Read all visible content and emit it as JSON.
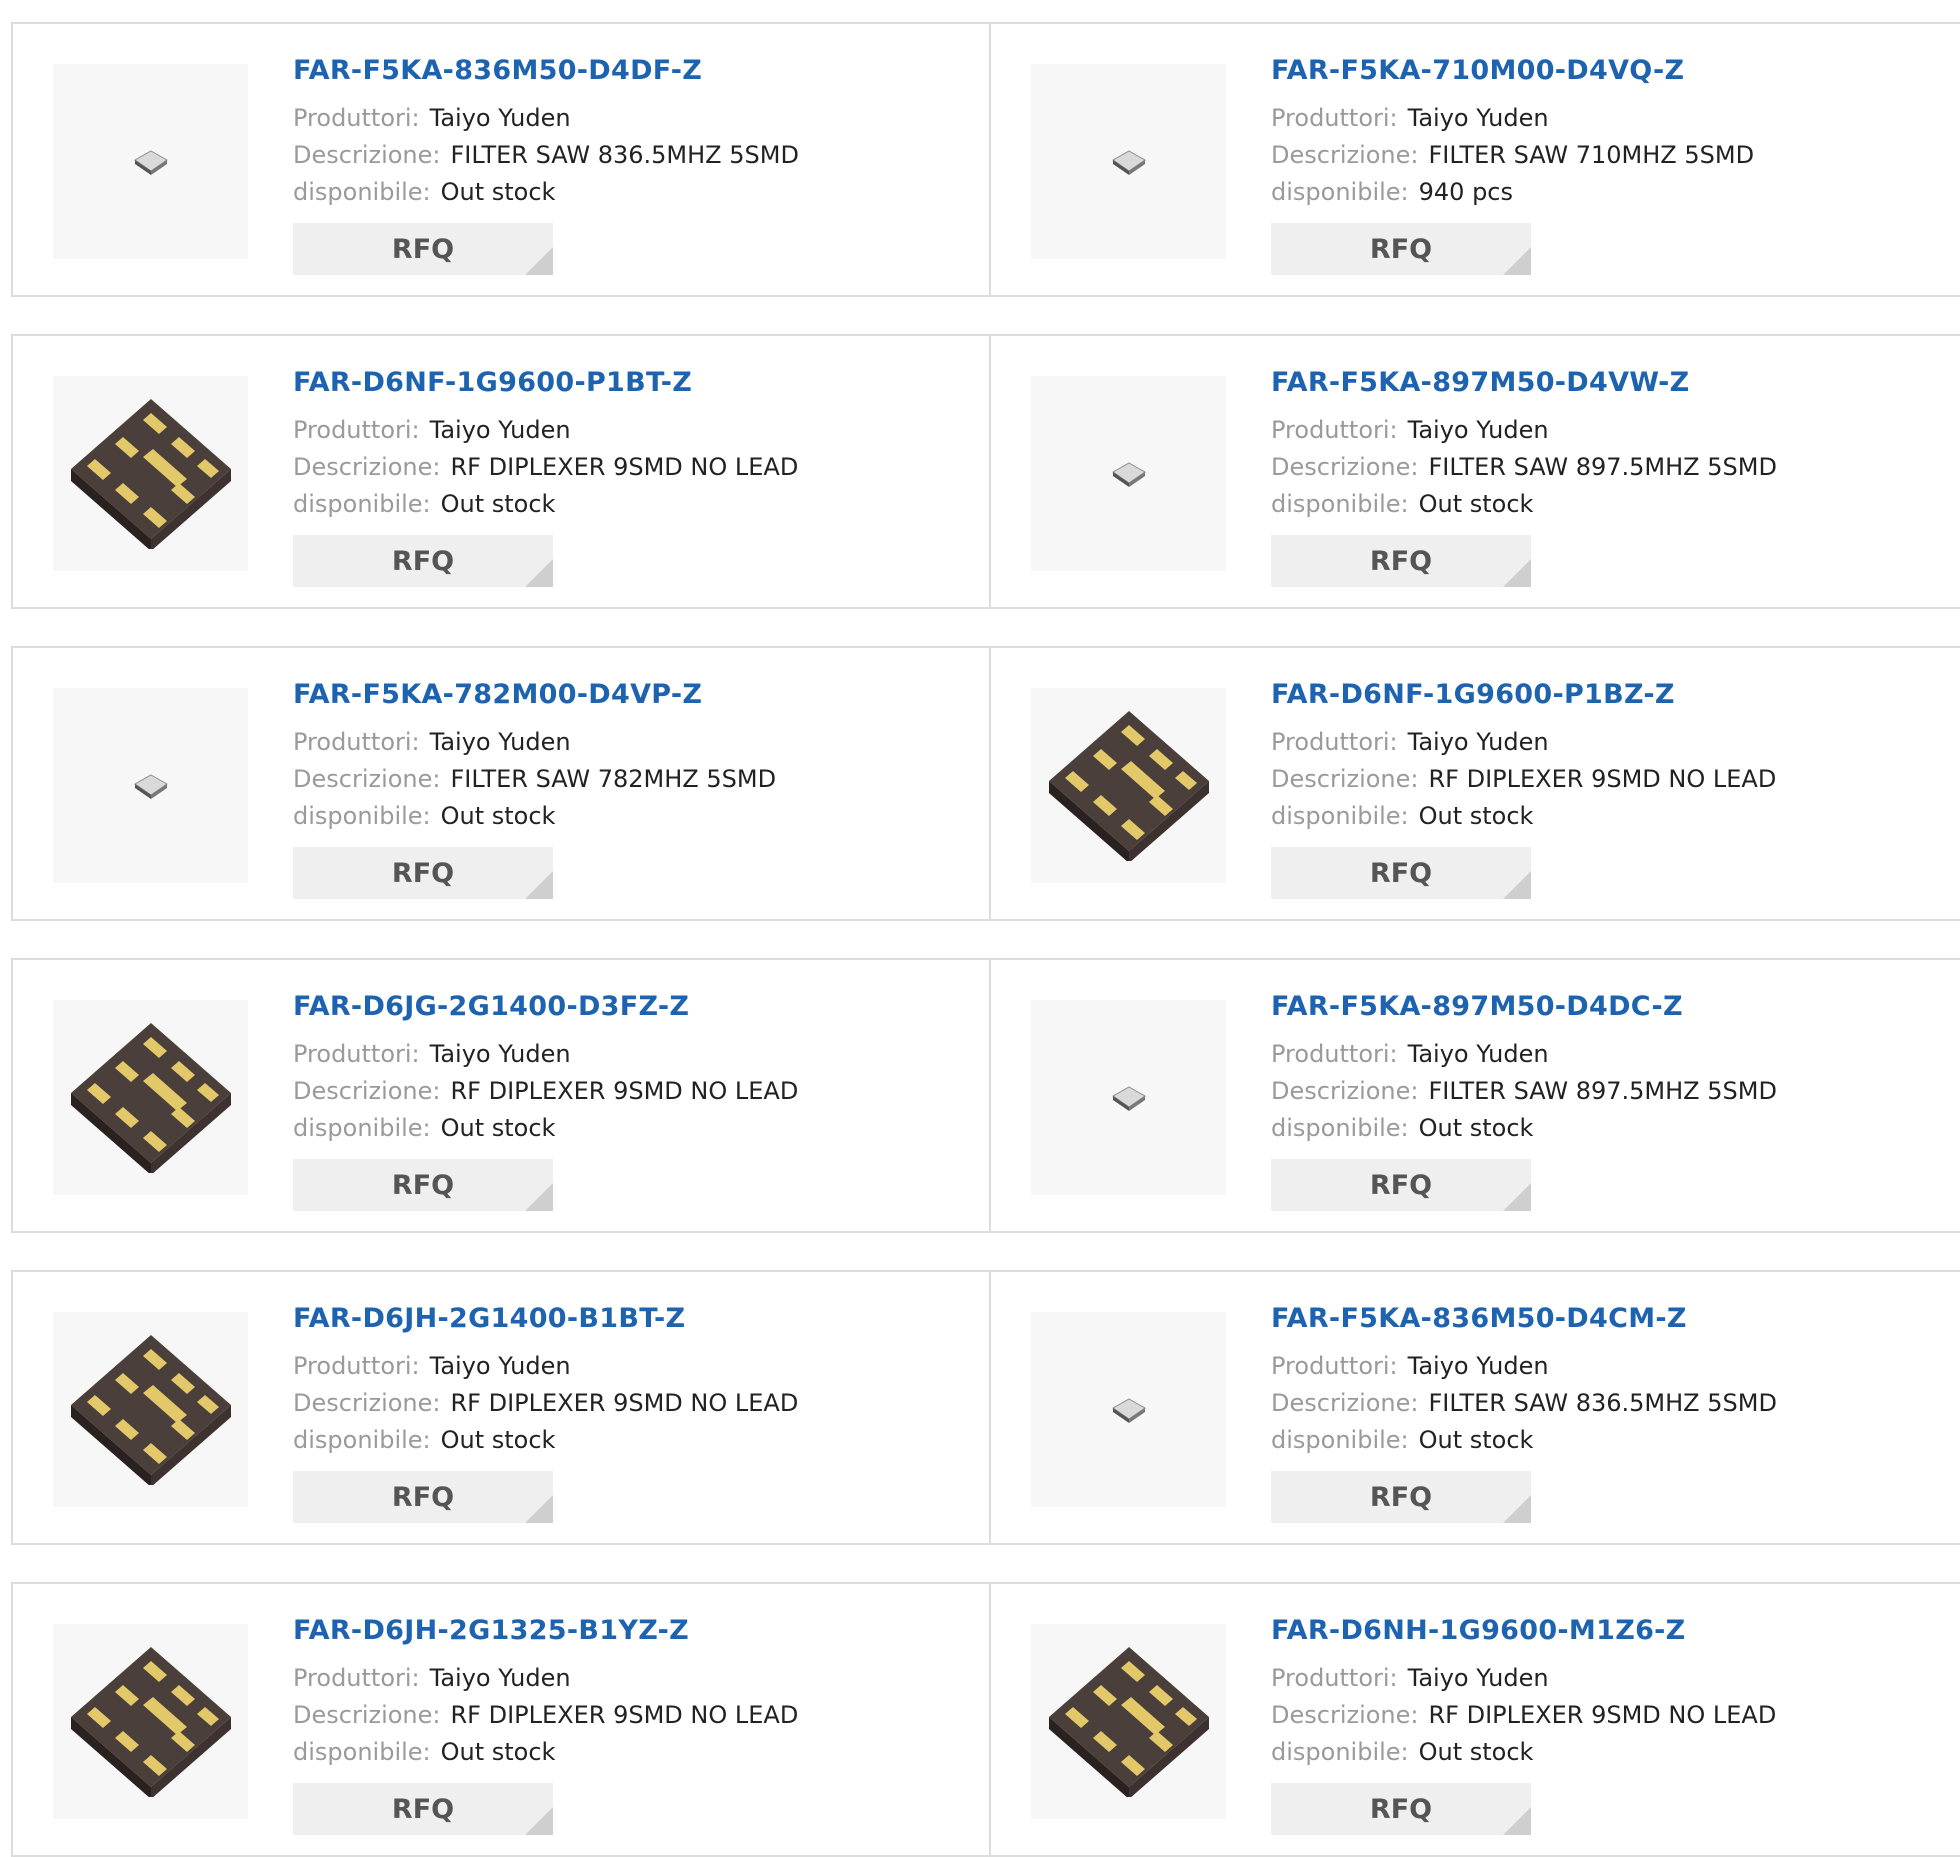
{
  "labels": {
    "manufacturer": "Produttori:",
    "description": "Descrizione:",
    "availability": "disponibile:",
    "rfq": "RFQ"
  },
  "products": [
    {
      "pn": "FAR-F5KA-836M50-D4DF-Z",
      "manufacturer": "Taiyo Yuden",
      "description": "FILTER SAW 836.5MHZ 5SMD",
      "availability": "Out stock",
      "image": "small-chip-icon"
    },
    {
      "pn": "FAR-F5KA-710M00-D4VQ-Z",
      "manufacturer": "Taiyo Yuden",
      "description": "FILTER SAW 710MHZ 5SMD",
      "availability": "940 pcs",
      "image": "small-chip-icon"
    },
    {
      "pn": "FAR-D6NF-1G9600-P1BT-Z",
      "manufacturer": "Taiyo Yuden",
      "description": "RF DIPLEXER 9SMD NO LEAD",
      "availability": "Out stock",
      "image": "diplexer-chip-icon"
    },
    {
      "pn": "FAR-F5KA-897M50-D4VW-Z",
      "manufacturer": "Taiyo Yuden",
      "description": "FILTER SAW 897.5MHZ 5SMD",
      "availability": "Out stock",
      "image": "small-chip-icon"
    },
    {
      "pn": "FAR-F5KA-782M00-D4VP-Z",
      "manufacturer": "Taiyo Yuden",
      "description": "FILTER SAW 782MHZ 5SMD",
      "availability": "Out stock",
      "image": "small-chip-icon"
    },
    {
      "pn": "FAR-D6NF-1G9600-P1BZ-Z",
      "manufacturer": "Taiyo Yuden",
      "description": "RF DIPLEXER 9SMD NO LEAD",
      "availability": "Out stock",
      "image": "diplexer-chip-icon"
    },
    {
      "pn": "FAR-D6JG-2G1400-D3FZ-Z",
      "manufacturer": "Taiyo Yuden",
      "description": "RF DIPLEXER 9SMD NO LEAD",
      "availability": "Out stock",
      "image": "diplexer-chip-icon"
    },
    {
      "pn": "FAR-F5KA-897M50-D4DC-Z",
      "manufacturer": "Taiyo Yuden",
      "description": "FILTER SAW 897.5MHZ 5SMD",
      "availability": "Out stock",
      "image": "small-chip-icon"
    },
    {
      "pn": "FAR-D6JH-2G1400-B1BT-Z",
      "manufacturer": "Taiyo Yuden",
      "description": "RF DIPLEXER 9SMD NO LEAD",
      "availability": "Out stock",
      "image": "diplexer-chip-icon"
    },
    {
      "pn": "FAR-F5KA-836M50-D4CM-Z",
      "manufacturer": "Taiyo Yuden",
      "description": "FILTER SAW 836.5MHZ 5SMD",
      "availability": "Out stock",
      "image": "small-chip-icon"
    },
    {
      "pn": "FAR-D6JH-2G1325-B1YZ-Z",
      "manufacturer": "Taiyo Yuden",
      "description": "RF DIPLEXER 9SMD NO LEAD",
      "availability": "Out stock",
      "image": "diplexer-chip-icon"
    },
    {
      "pn": "FAR-D6NH-1G9600-M1Z6-Z",
      "manufacturer": "Taiyo Yuden",
      "description": "RF DIPLEXER 9SMD NO LEAD",
      "availability": "Out stock",
      "image": "diplexer-chip-icon"
    }
  ]
}
